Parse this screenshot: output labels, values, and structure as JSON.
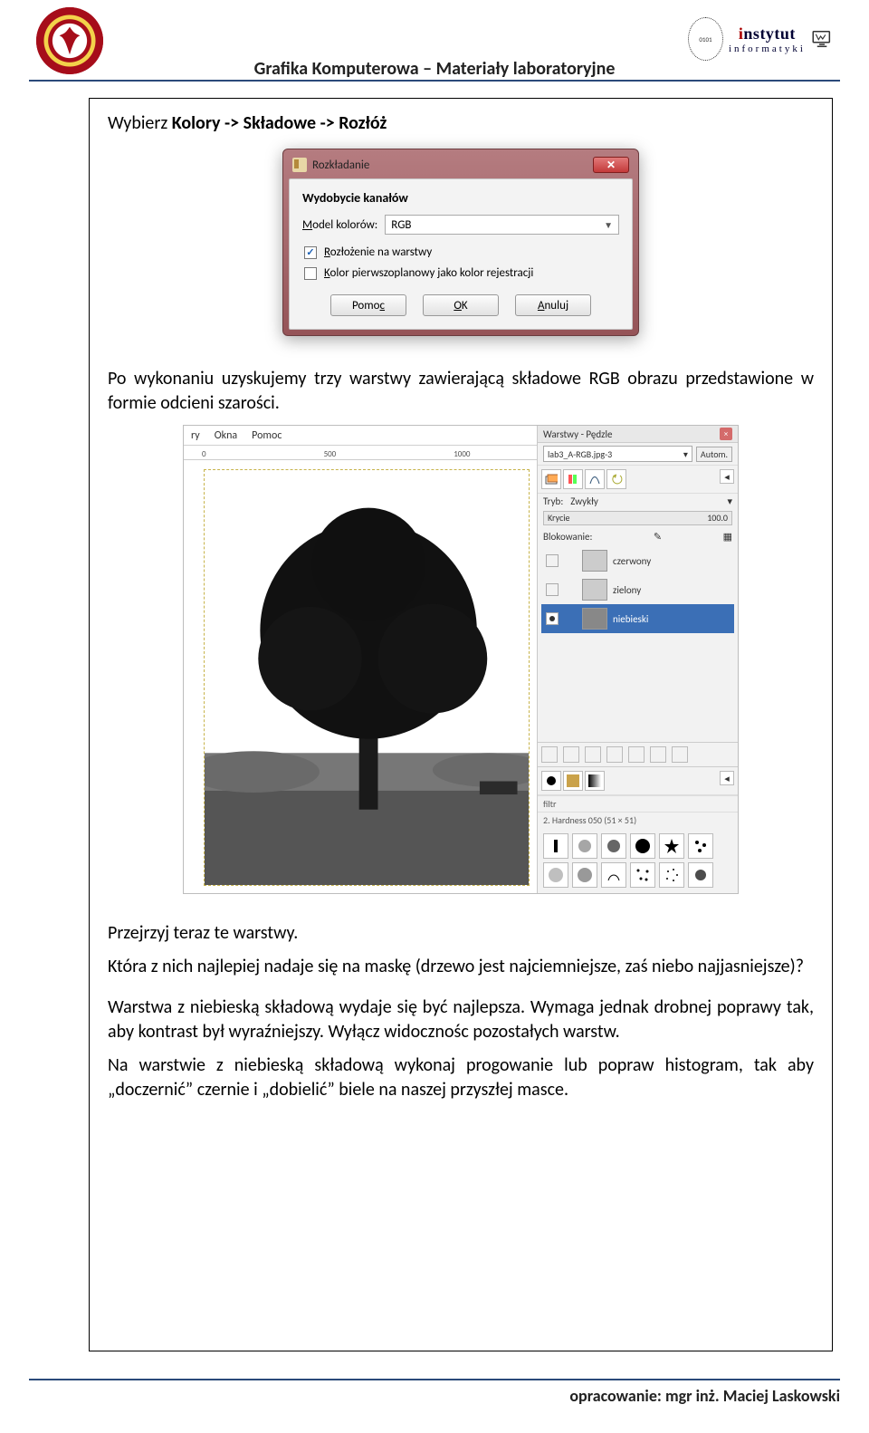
{
  "header": {
    "title": "Grafika Komputerowa – Materiały laboratoryjne",
    "logo_right_line1_pre": "i",
    "logo_right_line1_rest": "nstytut",
    "logo_right_line2": "informatyki"
  },
  "body": {
    "line1_pre": "Wybierz ",
    "line1_bold": "Kolory -> Składowe -> Rozłóż",
    "para2": "Po wykonaniu uzyskujemy trzy warstwy zawierającą składowe RGB obrazu przedstawione w formie odcieni szarości.",
    "para3": "Przejrzyj teraz te warstwy.",
    "para4": "Która z nich najlepiej nadaje się na maskę (drzewo jest najciemniejsze, zaś niebo najjasniejsze)?",
    "para5": "Warstwa z niebieską składową wydaje się być najlepsza. Wymaga jednak drobnej poprawy tak, aby kontrast był wyraźniejszy. Wyłącz widocznośc pozostałych warstw.",
    "para6": "Na warstwie z niebieską składową wykonaj progowanie lub popraw histogram, tak aby „doczernić” czernie i „dobielić” biele na naszej przyszłej masce."
  },
  "dialog": {
    "title": "Rozkładanie",
    "group": "Wydobycie kanałów",
    "model_label_u": "M",
    "model_label_rest": "odel kolorów:",
    "model_value": "RGB",
    "chk1_u": "R",
    "chk1_rest": "ozłożenie na warstwy",
    "chk2_u": "K",
    "chk2_rest": "olor pierwszoplanowy jako kolor rejestracji",
    "btn_help_u": "c",
    "btn_help": "Pomo",
    "btn_ok_u": "O",
    "btn_ok_rest": "K",
    "btn_cancel_u": "A",
    "btn_cancel_rest": "nuluj"
  },
  "gimp": {
    "menu": {
      "m1": "ry",
      "m2": "Okna",
      "m3": "Pomoc"
    },
    "ruler": {
      "t0": "0",
      "t1": "500",
      "t2": "1000"
    },
    "dock_title": "Warstwy - Pędzle",
    "image_name": "lab3_A-RGB.jpg-3",
    "autom": "Autom.",
    "mode_label": "Tryb:",
    "mode_value": "Zwykły",
    "opacity_label": "Krycie",
    "opacity_value": "100.0",
    "lock_label": "Blokowanie:",
    "layers": [
      {
        "name": "czerwony",
        "selected": false,
        "eye": false
      },
      {
        "name": "zielony",
        "selected": false,
        "eye": false
      },
      {
        "name": "niebieski",
        "selected": true,
        "eye": true
      }
    ],
    "filter_label": "filtr",
    "brush_name": "2. Hardness 050 (51 × 51)"
  },
  "footer": {
    "text": "opracowanie: mgr inż. Maciej Laskowski"
  }
}
